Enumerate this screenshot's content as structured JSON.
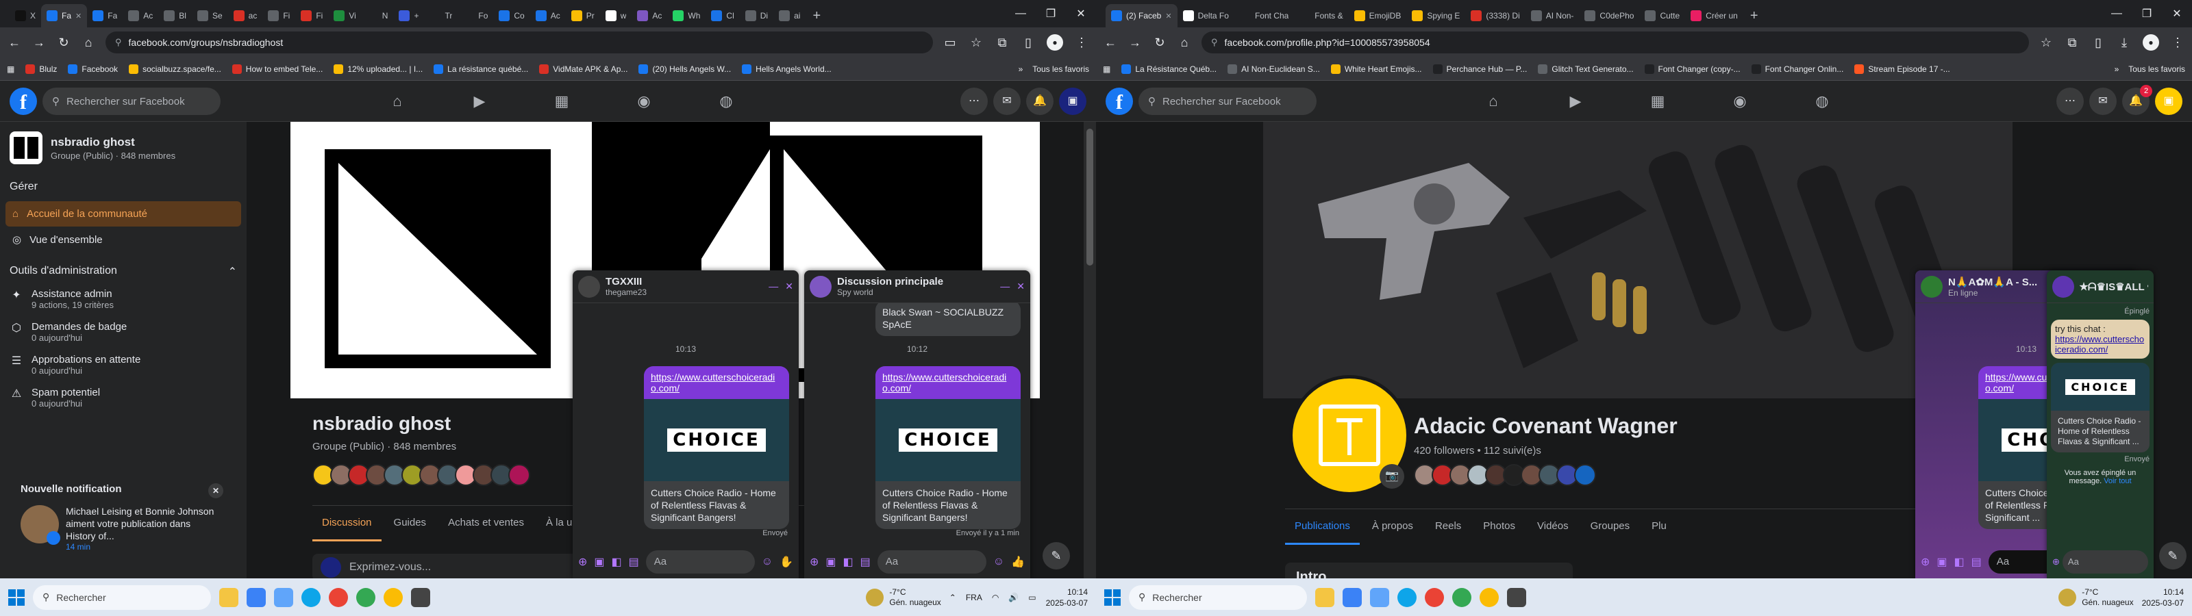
{
  "left": {
    "tabs": [
      {
        "label": "X",
        "color": "#111111"
      },
      {
        "label": "Fa",
        "color": "#1877f2",
        "active": true
      },
      {
        "label": "Fa",
        "color": "#1877f2"
      },
      {
        "label": "Ac",
        "color": "#5f6368"
      },
      {
        "label": "Bl",
        "color": "#5f6368"
      },
      {
        "label": "Se",
        "color": "#5f6368"
      },
      {
        "label": "ac",
        "color": "#d93025"
      },
      {
        "label": "Fi",
        "color": "#5f6368"
      },
      {
        "label": "Fi",
        "color": "#d93025"
      },
      {
        "label": "Vi",
        "color": "#1e8e3e"
      },
      {
        "label": "N",
        "color": "#202124"
      },
      {
        "label": "+",
        "color": "#3b5bdb"
      },
      {
        "label": "Tr",
        "color": "#202124"
      },
      {
        "label": "Fo",
        "color": "#202124"
      },
      {
        "label": "Co",
        "color": "#1a73e8"
      },
      {
        "label": "Ac",
        "color": "#1a73e8"
      },
      {
        "label": "Pr",
        "color": "#fbbc04"
      },
      {
        "label": "w",
        "color": "#ffffff"
      },
      {
        "label": "Ac",
        "color": "#7e57c2"
      },
      {
        "label": "Wh",
        "color": "#25d366"
      },
      {
        "label": "Cl",
        "color": "#1a73e8"
      },
      {
        "label": "Di",
        "color": "#5f6368"
      },
      {
        "label": "ai",
        "color": "#5f6368"
      }
    ],
    "url": "facebook.com/groups/nsbradioghost",
    "bookmarks": [
      {
        "label": "Blulz",
        "color": "#d93025"
      },
      {
        "label": "Facebook",
        "color": "#1877f2"
      },
      {
        "label": "socialbuzz.space/fe...",
        "color": "#fbbc04"
      },
      {
        "label": "How to embed Tele...",
        "color": "#d93025"
      },
      {
        "label": "12% uploaded... | I...",
        "color": "#fbbc04"
      },
      {
        "label": "La résistance québé...",
        "color": "#1877f2"
      },
      {
        "label": "VidMate APK & Ap...",
        "color": "#d93025"
      },
      {
        "label": "(20) Hells Angels W...",
        "color": "#1877f2"
      },
      {
        "label": "Hells Angels World...",
        "color": "#1877f2"
      }
    ],
    "bookmarks_more": "»",
    "bookmarks_all": "Tous les favoris",
    "fb_search_placeholder": "Rechercher sur Facebook",
    "notification_count": "",
    "group": {
      "name": "nsbradio ghost",
      "meta": "Groupe (Public) · 848 membres",
      "manage_label": "Gérer",
      "nav_active": "Accueil de la communauté",
      "nav_overview": "Vue d'ensemble",
      "admin_tools": "Outils d'administration",
      "admin_items": [
        {
          "title": "Assistance admin",
          "sub": "9 actions, 19 critères"
        },
        {
          "title": "Demandes de badge",
          "sub": "0 aujourd'hui"
        },
        {
          "title": "Approbations en attente",
          "sub": "0 aujourd'hui"
        },
        {
          "title": "Spam potentiel",
          "sub": "0 aujourd'hui"
        }
      ],
      "title": "nsbradio ghost",
      "title_meta": "Groupe (Public) · 848 membres",
      "tabs": [
        "Discussion",
        "Guides",
        "Achats et ventes",
        "À la u"
      ],
      "composer_placeholder": "Exprimez-vous..."
    },
    "notification": {
      "title": "Nouvelle notification",
      "text": "Michael Leising et Bonnie Johnson aiment votre publication dans History of...",
      "time": "14 min"
    },
    "chat1": {
      "name": "TGXXIII",
      "sub": "thegame23",
      "time": "10:13",
      "link": "https://www.cutterschoiceradio.com/",
      "preview": "Cutters Choice Radio - Home of Relentless Flavas & Significant Bangers!",
      "status": "Envoyé",
      "input": "Aa"
    },
    "chat2": {
      "name": "Discussion principale",
      "sub": "Spy world",
      "prev_text": "Black Swan ~ SOCIALBUZZ SpAcE",
      "time": "10:12",
      "link": "https://www.cutterschoiceradio.com/",
      "preview": "Cutters Choice Radio - Home of Relentless Flavas & Significant Bangers!",
      "status": "Envoyé il y a 1 min",
      "input": "Aa"
    },
    "taskbar": {
      "search": "Rechercher",
      "weather_temp": "-7°C",
      "weather_desc": "Gén. nuageux",
      "lang": "FRA",
      "time": "10:14",
      "date": "2025-03-07"
    }
  },
  "right": {
    "tabs": [
      {
        "label": "(2) Faceb",
        "color": "#1877f2",
        "active": true
      },
      {
        "label": "Delta Fo",
        "color": "#ffffff"
      },
      {
        "label": "Font Cha",
        "color": "#202124"
      },
      {
        "label": "Fonts &",
        "color": "#202124"
      },
      {
        "label": "EmojiDB",
        "color": "#fbbc04"
      },
      {
        "label": "Spying E",
        "color": "#fbbc04"
      },
      {
        "label": "(3338) Di",
        "color": "#d93025"
      },
      {
        "label": "AI Non-",
        "color": "#5f6368"
      },
      {
        "label": "C0dePho",
        "color": "#5f6368"
      },
      {
        "label": "Cutte",
        "color": "#5f6368"
      },
      {
        "label": "Créer un",
        "color": "#e91e63"
      }
    ],
    "url": "facebook.com/profile.php?id=100085573958054",
    "bookmarks": [
      {
        "label": "La Résistance Québ...",
        "color": "#1877f2"
      },
      {
        "label": "AI Non-Euclidean S...",
        "color": "#5f6368"
      },
      {
        "label": "White Heart Emojis...",
        "color": "#fbbc04"
      },
      {
        "label": "Perchance Hub — P...",
        "color": "#202124"
      },
      {
        "label": "Glitch Text Generato...",
        "color": "#5f6368"
      },
      {
        "label": "Font Changer (copy-...",
        "color": "#202124"
      },
      {
        "label": "Font Changer Onlin...",
        "color": "#202124"
      },
      {
        "label": "Stream Episode 17 -...",
        "color": "#ff5722"
      }
    ],
    "bookmarks_more": "»",
    "bookmarks_all": "Tous les favoris",
    "fb_search_placeholder": "Rechercher sur Facebook",
    "notification_count": "2",
    "profile": {
      "name": "Adacic Covenant Wagner",
      "meta": "420 followers • 112 suivi(e)s",
      "tabs": [
        "Publications",
        "À propos",
        "Reels",
        "Photos",
        "Vidéos",
        "Groupes",
        "Plu"
      ],
      "intro": "Intro"
    },
    "chat1": {
      "name": "N🙏A✿M🙏A - S...",
      "sub": "En ligne",
      "time": "10:13",
      "link": "https://www.cutterschoiceradio.com/",
      "preview": "Cutters Choice Radio - Home of Relentless Flavas & Significant ...",
      "input": "Aa"
    },
    "chat2": {
      "name": "★ᗩ♛IS♛ALL ✿",
      "pinned_label": "Épinglé",
      "intro": "try this chat :",
      "link": "https://www.cutterschoiceradio.com/",
      "preview": "Cutters Choice Radio - Home of Relentless Flavas & Significant ...",
      "status": "Envoyé",
      "pinned_notice": "Vous avez épinglé un message.",
      "pinned_link": "Voir tout",
      "input": "Aa"
    },
    "taskbar": {
      "search": "Rechercher",
      "weather_temp": "-7°C",
      "weather_desc": "Gén. nuageux",
      "time": "10:14",
      "date": "2025-03-07"
    }
  }
}
